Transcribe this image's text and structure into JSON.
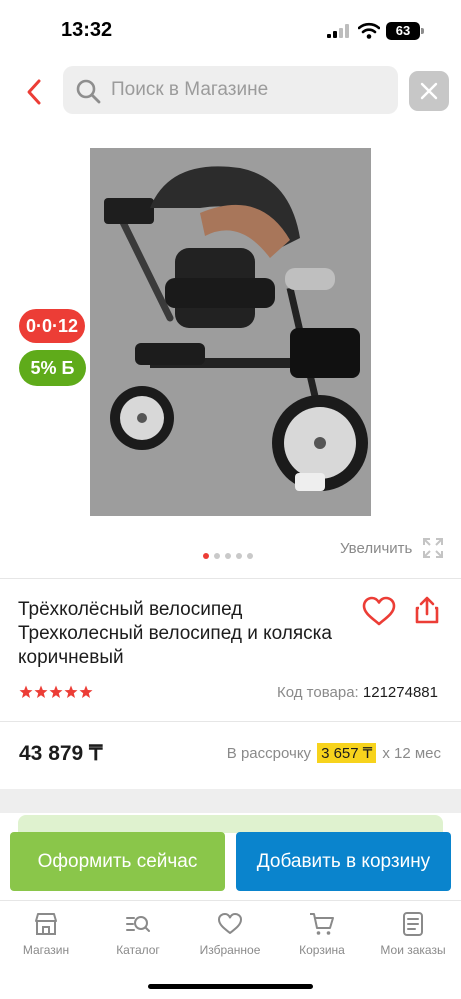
{
  "status_bar": {
    "time": "13:32",
    "battery": "63",
    "icons": [
      "signal-icon",
      "wifi-icon",
      "battery-icon"
    ]
  },
  "search": {
    "placeholder": "Поиск в Магазине",
    "value": "",
    "icons": [
      "back-arrow-icon",
      "search-icon",
      "close-icon"
    ]
  },
  "badges": {
    "installment": "0·0·12",
    "bonus": "5% Б"
  },
  "gallery": {
    "image_count": 5,
    "active_index": 0,
    "zoom_label": "Увеличить"
  },
  "product": {
    "title": "Трёхколёсный велосипед Трехколесный велосипед и коляска коричневый",
    "rating": 5,
    "sku_label": "Код товара:",
    "sku_value": "121274881",
    "price": "43 879 ₸",
    "installment_prefix": "В рассрочку",
    "installment_amount": "3 657 ₸",
    "installment_suffix": "х 12 мес"
  },
  "actions": {
    "checkout": "Оформить сейчас",
    "add_to_cart": "Добавить в корзину"
  },
  "tabbar": {
    "items": [
      {
        "label": "Магазин",
        "icon": "store-icon"
      },
      {
        "label": "Каталог",
        "icon": "catalog-icon"
      },
      {
        "label": "Избранное",
        "icon": "heart-icon"
      },
      {
        "label": "Корзина",
        "icon": "cart-icon"
      },
      {
        "label": "Мои заказы",
        "icon": "orders-icon"
      }
    ]
  },
  "colors": {
    "accent_red": "#ec3d36",
    "bonus_green": "#5fab1a",
    "checkout_green": "#8ac64a",
    "cart_blue": "#0a84cd",
    "installment_yellow": "#f7d31c"
  }
}
